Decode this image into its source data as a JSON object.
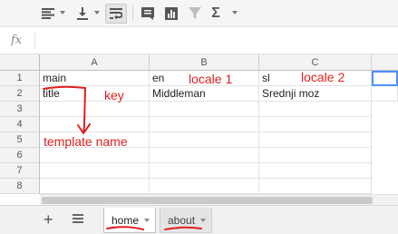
{
  "toolbar": {
    "icons": [
      "align-left-icon",
      "valign-bottom-icon",
      "wrap-text-icon",
      "comment-icon",
      "chart-icon",
      "filter-icon",
      "sum-icon"
    ],
    "sum_symbol": "Σ"
  },
  "formula_bar": {
    "fx_label": "fx",
    "value": ""
  },
  "grid": {
    "columns": [
      "A",
      "B",
      "C"
    ],
    "rows": [
      "1",
      "2",
      "3",
      "4",
      "5",
      "6",
      "7",
      "8"
    ],
    "cells": {
      "A1": "main",
      "B1": "en",
      "C1": "sl",
      "A2": "title",
      "B2": "Middleman",
      "C2": "Srednji moz"
    }
  },
  "sheets": {
    "tabs": [
      {
        "label": "home",
        "active": true
      },
      {
        "label": "about",
        "active": false
      }
    ]
  },
  "annotations": {
    "key": "key",
    "locale1": "locale 1",
    "locale2": "locale 2",
    "template_name": "template name",
    "color": "#e02020"
  }
}
